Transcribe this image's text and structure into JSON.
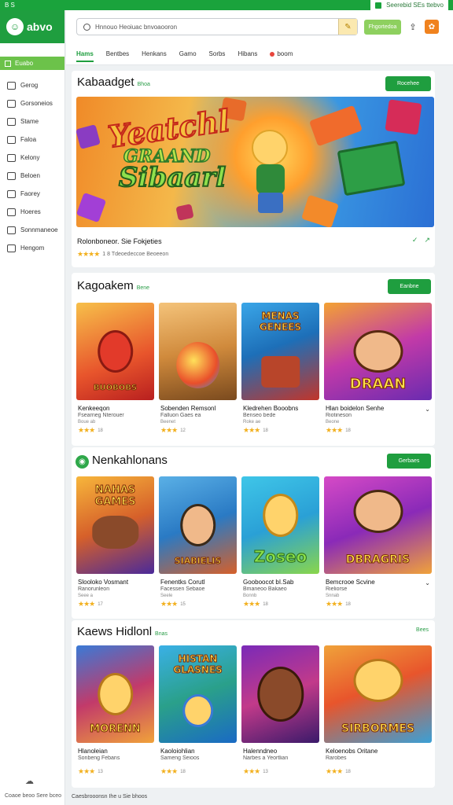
{
  "sysbar": {
    "left": "B  S",
    "right": "Seerebid SEs ttebvo"
  },
  "brand": {
    "name": "abvo"
  },
  "sidebar": {
    "active": "Euabo",
    "items": [
      {
        "label": "Gerog",
        "icon": "list-icon"
      },
      {
        "label": "Gorsoneios",
        "icon": "calendar-icon"
      },
      {
        "label": "Stame",
        "icon": "box-icon"
      },
      {
        "label": "Faloa",
        "icon": "book-icon"
      },
      {
        "label": "Kelony",
        "icon": "bookmark-icon"
      },
      {
        "label": "Beloen",
        "icon": "grid-icon"
      },
      {
        "label": "Faorey",
        "icon": "paw-icon"
      },
      {
        "label": "Hoeres",
        "icon": "home-icon"
      },
      {
        "label": "Sonnmaneoe",
        "icon": "target-icon"
      },
      {
        "label": "Hengom",
        "icon": "square-icon"
      }
    ],
    "footer": "Coaoe beoo Sere bceo"
  },
  "header": {
    "search_placeholder": "Hnnouo Heoiuac bnvoaooron",
    "green_button": "Fhgortedoa"
  },
  "tabs": [
    {
      "label": "Hams",
      "active": true
    },
    {
      "label": "Bentbes",
      "active": false
    },
    {
      "label": "Henkans",
      "active": false
    },
    {
      "label": "Gamo",
      "active": false
    },
    {
      "label": "Sorbs",
      "active": false
    },
    {
      "label": "Hibans",
      "active": false
    },
    {
      "label": "boom",
      "active": false,
      "dot": true
    }
  ],
  "featured": {
    "title": "Kabaadget",
    "sub": "Bhoa",
    "button": "Rocehee",
    "banner_title_1": "Yeatchl",
    "banner_title_2": "GRAAND",
    "banner_title_3": "Sibaarl",
    "caption": "Rolonboneor. Sie Fokjeties",
    "rating_text": "1 8  Tdeoedeccoe Beoeeon",
    "stars": "★★★★"
  },
  "section2": {
    "title": "Kagoakem",
    "sub": "Bene",
    "button": "Eanbne",
    "cards": [
      {
        "art_word": "BUOBOBS",
        "t1": "Kenkeeqon",
        "t2": "Fsearneg Nterouer",
        "t3": "Boue ab",
        "stars": "★★★",
        "count": "18"
      },
      {
        "art_word": "",
        "t1": "Sobenden Remsonl",
        "t2": "Falluon Gaes ea",
        "t3": "Beenet",
        "stars": "★★★",
        "count": "12"
      },
      {
        "art_word": "MENAS GENEES",
        "t1": "Kledrehen Booobns",
        "t2": "Benseo bede",
        "t3": "Roke ae",
        "stars": "★★★",
        "count": "18"
      },
      {
        "art_word": "DRAAN",
        "t1": "Hlan boidelon Senhe",
        "t2": "Riotineson",
        "t3": "Beone",
        "stars": "★★★",
        "count": "18"
      }
    ]
  },
  "section3": {
    "title": "Nenkahlonans",
    "button": "Gerbaes",
    "cards": [
      {
        "art_word": "NAHAS GAMES",
        "t1": "Slooloko Vosmant",
        "t2": "Ranorunleon",
        "t3": "Seee a",
        "stars": "★★★",
        "count": "17"
      },
      {
        "art_word": "SIABIELIS",
        "t1": "Fenentks Corutl",
        "t2": "Facessen Sebaoe",
        "t3": "Seele",
        "stars": "★★★",
        "count": "15"
      },
      {
        "art_word": "Zoseo",
        "t1": "Gooboocot bI.Sab",
        "t2": "Bmaneoo Bakaeo",
        "t3": "Bonnb",
        "stars": "★★★",
        "count": "18"
      },
      {
        "art_word": "DBRAGRIS",
        "t1": "Bemcrooe Scvine",
        "t2": "Rieliorse",
        "t3": "Snnab",
        "stars": "★★★",
        "count": "18"
      }
    ]
  },
  "section4": {
    "title": "Kaews Hidlonl",
    "sub": "Bnas",
    "link": "Bees",
    "cards": [
      {
        "art_word": "MORENN",
        "t1": "Hlanoleian",
        "t2": "Sonbeng Febans",
        "stars": "★★★",
        "count": "13"
      },
      {
        "art_word": "HISTAN GLASNES",
        "t1": "Kaoloiohlian",
        "t2": "Sameng Seioos",
        "stars": "★★★",
        "count": "18"
      },
      {
        "art_word": "",
        "t1": "Halenndneo",
        "t2": "Narbes a Yeortlian",
        "stars": "★★★",
        "count": "13"
      },
      {
        "art_word": "SIRBORMES",
        "t1": "Keloenobs Oritane",
        "t2": "Rarobes",
        "stars": "★★★",
        "count": "18"
      }
    ]
  },
  "bottom": {
    "text": "Caesbrooonsn Ihe u Sie bhoos"
  },
  "colors": {
    "brand_green": "#1f9e3f",
    "accent_orange": "#f0821e",
    "star": "#f2b01e"
  }
}
